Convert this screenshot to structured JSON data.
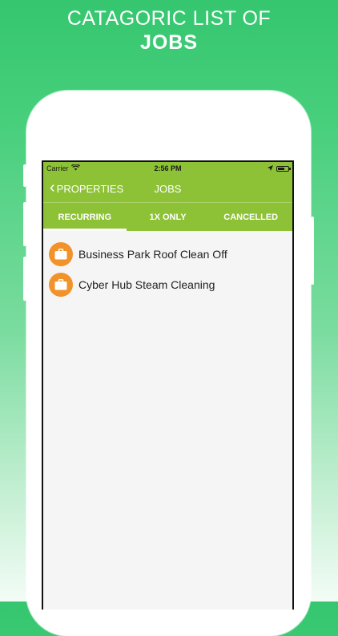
{
  "headline": {
    "line1": "CATAGORIC LIST OF",
    "line2": "JOBS"
  },
  "statusbar": {
    "carrier": "Carrier",
    "time": "2:56 PM"
  },
  "navbar": {
    "back_label": "PROPERTIES",
    "title": "JOBS"
  },
  "tabs": [
    {
      "label": "RECURRING",
      "active": true
    },
    {
      "label": "1X ONLY",
      "active": false
    },
    {
      "label": "CANCELLED",
      "active": false
    }
  ],
  "jobs": [
    {
      "label": "Business Park Roof Clean Off",
      "icon": "briefcase-icon"
    },
    {
      "label": "Cyber Hub Steam Cleaning",
      "icon": "briefcase-icon"
    }
  ],
  "colors": {
    "brand_green": "#8dc236",
    "badge_orange": "#f2922a",
    "background_green": "#35c66f"
  }
}
